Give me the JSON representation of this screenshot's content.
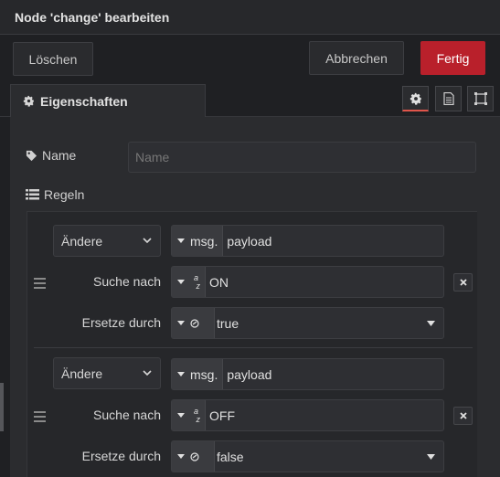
{
  "title": "Node 'change' bearbeiten",
  "toolbar": {
    "delete_label": "Löschen",
    "cancel_label": "Abbrechen",
    "done_label": "Fertig"
  },
  "tabs": {
    "properties_label": "Eigenschaften",
    "icons": [
      "gear-icon",
      "document-icon",
      "frame-icon"
    ]
  },
  "form": {
    "name_label": "Name",
    "name_placeholder": "Name",
    "name_value": "",
    "rules_label": "Regeln"
  },
  "rules": [
    {
      "action": "Ändere",
      "target_prefix": "msg.",
      "target": "payload",
      "search_label": "Suche nach",
      "search_type": "az",
      "search_value": "ON",
      "replace_label": "Ersetze durch",
      "replace_type": "boolean",
      "replace_value": "true"
    },
    {
      "action": "Ändere",
      "target_prefix": "msg.",
      "target": "payload",
      "search_label": "Suche nach",
      "search_type": "az",
      "search_value": "OFF",
      "replace_label": "Ersetze durch",
      "replace_type": "boolean",
      "replace_value": "false"
    }
  ],
  "colors": {
    "accent": "#b9202b",
    "active_tab_underline": "#e0554b",
    "background": "#1f2023",
    "panel": "#2b2c2f"
  }
}
